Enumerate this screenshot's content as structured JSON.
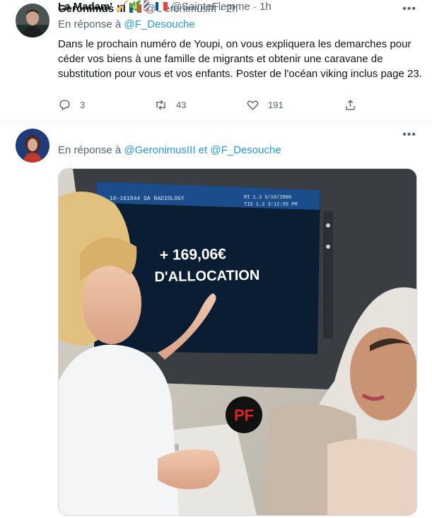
{
  "tweet1": {
    "author_name": "Geronimus III",
    "handle": "@GeronimusIII",
    "separator": "·",
    "time": "2h",
    "reply_prefix": "En réponse à",
    "reply_to": "@F_Desouche",
    "text": "Dans le prochain numéro de Youpi, on vous expliquera les demarches pour céder vos biens à une famille de migrants et obtenir une caravane de substitution pour vous et vos enfants. Poster de l'océan viking inclus page 23.",
    "reply_count": "3",
    "retweet_count": "43",
    "like_count": "191"
  },
  "tweet2": {
    "author_name": "La Madam'",
    "handle": "@SainteFlemme",
    "separator": "·",
    "time": "1h",
    "reply_prefix": "En réponse à",
    "reply_to_1": "@GeronimusIII",
    "reply_joiner": "et",
    "reply_to_2": "@F_Desouche",
    "image": {
      "screen_header_left": "10-161844  SA RADIOLOGY",
      "screen_header_right_1": "MI 1.3   5/10/2006",
      "screen_header_right_2": "TIS 1.2   3:12:55 PM",
      "screen_line_1": "+ 169,06€",
      "screen_line_2": "D'ALLOCATION",
      "watermark": "PF"
    }
  },
  "colors": {
    "accent": "#1d9bf0",
    "muted": "#536471",
    "text": "#0f1419",
    "flag_blue": "#0055a4",
    "flag_red": "#ef4135"
  },
  "icons": [
    "reply-icon",
    "retweet-icon",
    "like-icon",
    "share-icon",
    "more-icon",
    "broom-emoji",
    "herb-emoji",
    "barber-pole-emoji",
    "france-flag"
  ]
}
